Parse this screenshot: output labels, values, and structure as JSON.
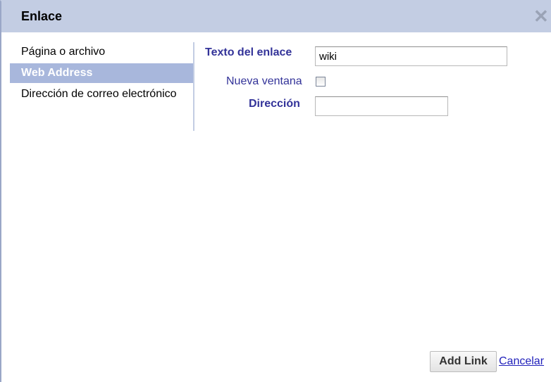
{
  "dialog": {
    "title": "Enlace",
    "close_glyph": "✕"
  },
  "sidebar": {
    "items": [
      {
        "label": "Página o archivo"
      },
      {
        "label": "Web Address",
        "selected": true
      },
      {
        "label": "Dirección de correo electrónico"
      }
    ]
  },
  "form": {
    "link_text_label": "Texto del enlace",
    "link_text_value": "wiki",
    "new_window_label": "Nueva ventana",
    "new_window_checked": false,
    "address_label": "Dirección",
    "address_value": ""
  },
  "actions": {
    "add_label": "Add Link",
    "cancel_label": "Cancelar"
  },
  "colors": {
    "title_bar": "#c3cde3",
    "selected_item": "#a8b7dc",
    "label_text": "#333399",
    "link": "#2222bb"
  },
  "icons": {
    "close": "close-icon"
  }
}
